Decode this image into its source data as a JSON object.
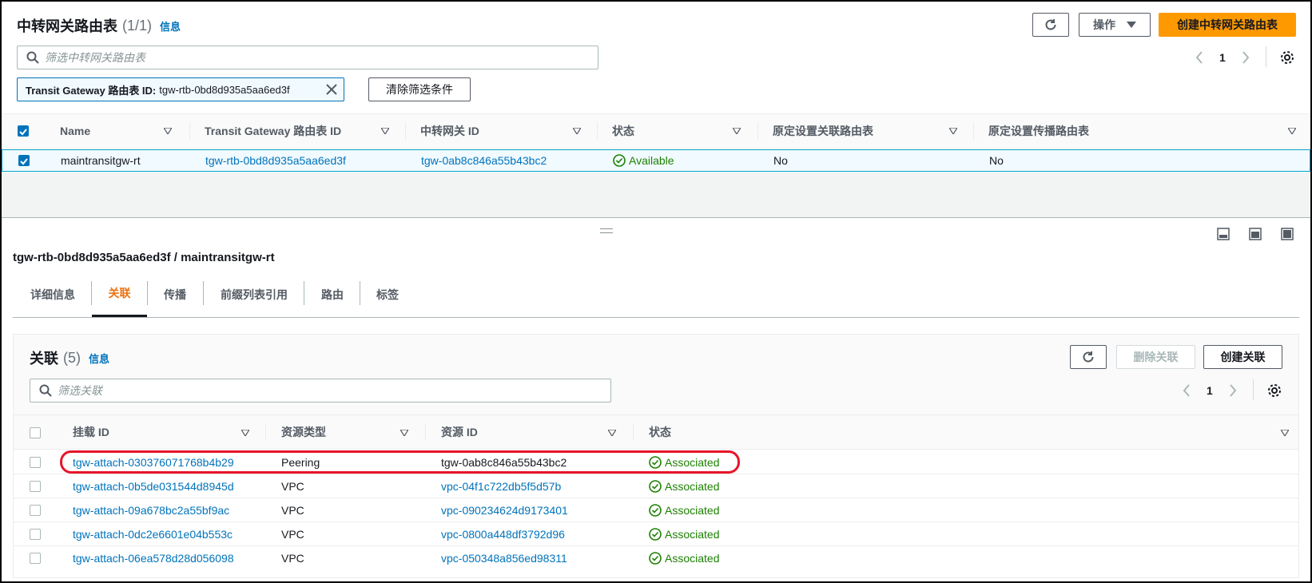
{
  "top": {
    "title": "中转网关路由表",
    "count": "(1/1)",
    "info": "信息",
    "actions_label": "操作",
    "create_label": "创建中转网关路由表",
    "filter_placeholder": "筛选中转网关路由表",
    "page_number": "1",
    "token_key": "Transit Gateway 路由表 ID:",
    "token_value": "tgw-rtb-0bd8d935a5aa6ed3f",
    "clear_filters": "清除筛选条件",
    "columns": [
      "Name",
      "Transit Gateway 路由表 ID",
      "中转网关 ID",
      "状态",
      "原定设置关联路由表",
      "原定设置传播路由表"
    ],
    "row": {
      "name": "maintransitgw-rt",
      "rtb_id": "tgw-rtb-0bd8d935a5aa6ed3f",
      "tgw_id": "tgw-0ab8c846a55b43bc2",
      "status": "Available",
      "default_assoc": "No",
      "default_prop": "No"
    }
  },
  "detail": {
    "title": "tgw-rtb-0bd8d935a5aa6ed3f / maintransitgw-rt",
    "tabs": [
      "详细信息",
      "关联",
      "传播",
      "前缀列表引用",
      "路由",
      "标签"
    ],
    "active_tab_color": "#ec7211"
  },
  "assoc": {
    "title": "关联",
    "count": "(5)",
    "info": "信息",
    "delete_label": "删除关联",
    "create_label": "创建关联",
    "filter_placeholder": "筛选关联",
    "page_number": "1",
    "columns": [
      "挂载 ID",
      "资源类型",
      "资源 ID",
      "状态"
    ],
    "rows": [
      {
        "attach_id": "tgw-attach-030376071768b4b29",
        "type": "Peering",
        "resource_id": "tgw-0ab8c846a55b43bc2",
        "status": "Associated"
      },
      {
        "attach_id": "tgw-attach-0b5de031544d8945d",
        "type": "VPC",
        "resource_id": "vpc-04f1c722db5f5d57b",
        "status": "Associated"
      },
      {
        "attach_id": "tgw-attach-09a678bc2a55bf9ac",
        "type": "VPC",
        "resource_id": "vpc-090234624d9173401",
        "status": "Associated"
      },
      {
        "attach_id": "tgw-attach-0dc2e6601e04b553c",
        "type": "VPC",
        "resource_id": "vpc-0800a448df3792d96",
        "status": "Associated"
      },
      {
        "attach_id": "tgw-attach-06ea578d28d056098",
        "type": "VPC",
        "resource_id": "vpc-050348a856ed98311",
        "status": "Associated"
      }
    ]
  },
  "colors": {
    "link": "#0073bb",
    "primary": "#ff9900",
    "success": "#1d8102",
    "highlight": "#e8152a"
  }
}
